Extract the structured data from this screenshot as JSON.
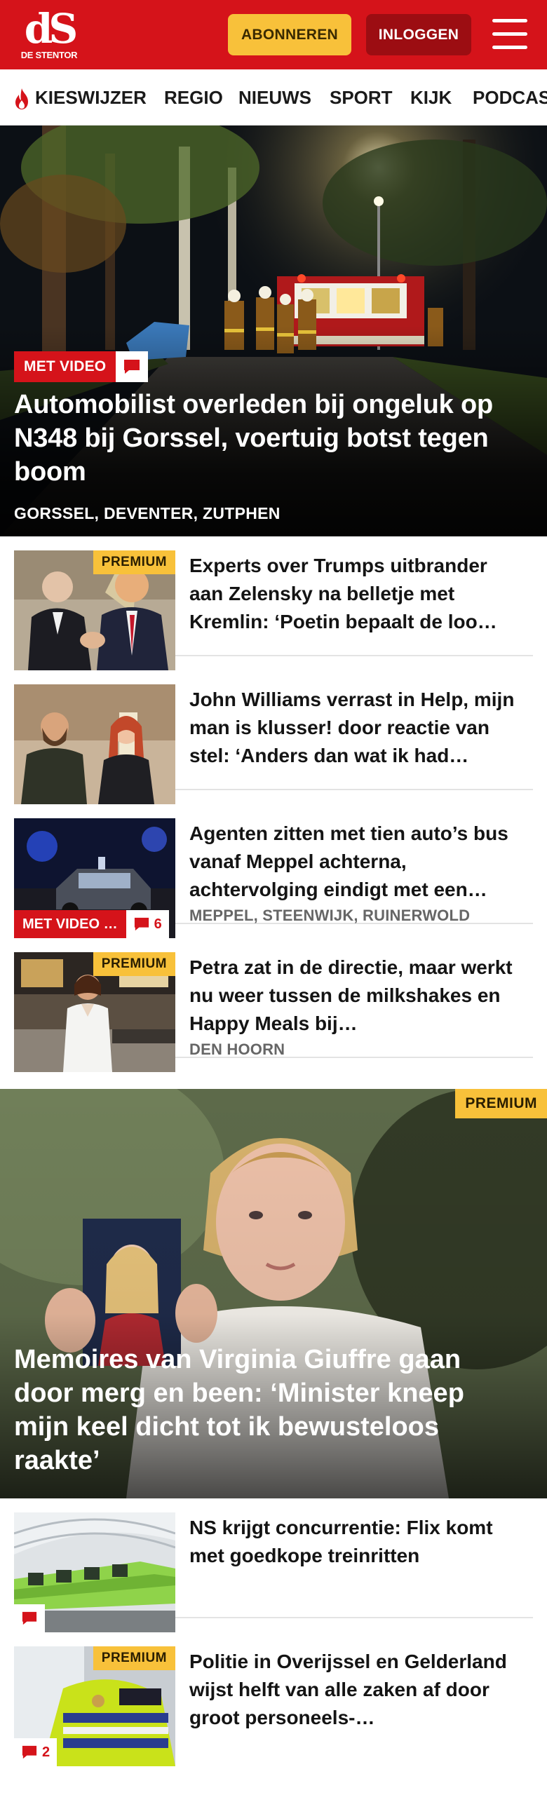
{
  "header": {
    "logo_mark": "dS",
    "logo_name": "DE STENTOR",
    "subscribe_label": "ABONNEREN",
    "login_label": "INLOGGEN",
    "brand_color": "#d5131a",
    "subscribe_color": "#f8c13a"
  },
  "nav": {
    "items": [
      {
        "label": "KIESWIJZER",
        "icon": "flame-icon"
      },
      {
        "label": "REGIO"
      },
      {
        "label": "NIEUWS"
      },
      {
        "label": "SPORT"
      },
      {
        "label": "KIJK"
      },
      {
        "label": "PODCAS"
      }
    ]
  },
  "hero": {
    "badge": "MET VIDEO",
    "badge_icon": "comment-icon",
    "title": "Automobilist overleden bij ongeluk op N348 bij Gorssel, voertuig botst tegen boom",
    "tags": "GORSSEL, DEVENTER, ZUTPHEN"
  },
  "articles": [
    {
      "premium": "PREMIUM",
      "title": "Experts over Trumps uitbrander aan Zelensky na belletje met Kremlin: ‘Poetin bepaalt de loo…"
    },
    {
      "title": "John Williams verrast in Help, mijn man is klusser! door reactie van stel: ‘Anders dan wat ik had…"
    },
    {
      "video_badge": "MET VIDEO …",
      "comment_count": "6",
      "title": "Agenten zitten met tien auto’s bus vanaf Meppel achterna, achtervolging eindigt met een…",
      "tags": "MEPPEL, STEENWIJK, RUINERWOLD"
    },
    {
      "premium": "PREMIUM",
      "title": "Petra zat in de directie, maar werkt nu weer tussen de milkshakes en Happy Meals bij…",
      "tags": "DEN HOORN"
    }
  ],
  "feature": {
    "premium": "PREMIUM",
    "title": "Memoires van Virginia Giuffre gaan door merg en been: ‘Minister kneep mijn keel dicht tot ik bewusteloos raakte’"
  },
  "articles2": [
    {
      "title": "NS krijgt concurrentie: Flix komt met goedkope treinritten"
    },
    {
      "premium": "PREMIUM",
      "comment_count": "2",
      "title": "Politie in Overijssel en Gelderland wijst helft van alle zaken af door groot personeels-…"
    }
  ]
}
